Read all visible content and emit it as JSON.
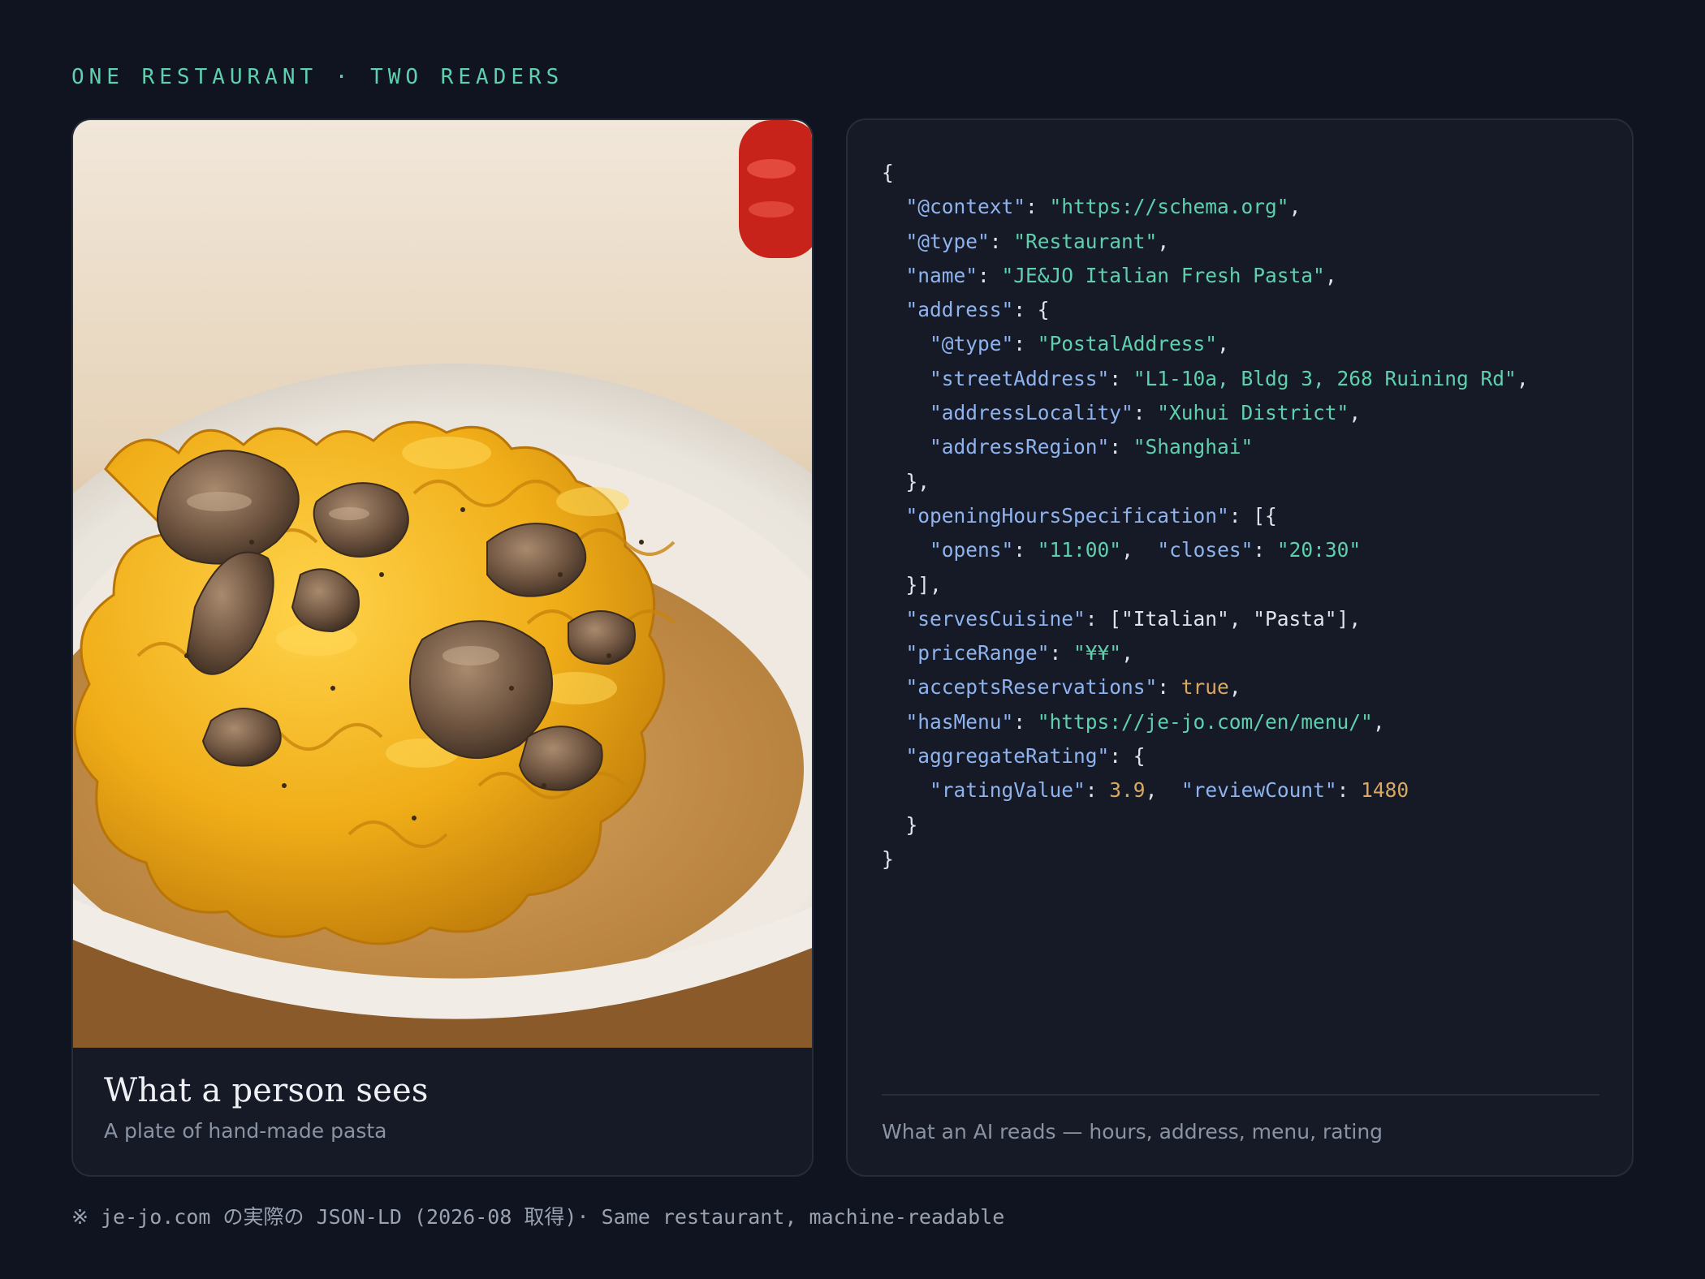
{
  "eyebrow": "ONE RESTAURANT · TWO READERS",
  "person_card": {
    "image_alt": "A plate of hand-made pasta with mushrooms in cream sauce",
    "title": "What a person sees",
    "subtitle": "A plate of hand-made pasta"
  },
  "ai_card": {
    "json_ld": {
      "open_brace": "{",
      "context_key": "\"@context\"",
      "context_val": "\"https://schema.org\"",
      "type_key": "\"@type\"",
      "type_val": "\"Restaurant\"",
      "name_key": "\"name\"",
      "name_val": "\"JE&JO Italian Fresh Pasta\"",
      "address_key": "\"address\"",
      "addr_type_key": "\"@type\"",
      "addr_type_val": "\"PostalAddress\"",
      "street_key": "\"streetAddress\"",
      "street_val": "\"L1-10a, Bldg 3, 268 Ruining Rd\"",
      "locality_key": "\"addressLocality\"",
      "locality_val": "\"Xuhui District\"",
      "region_key": "\"addressRegion\"",
      "region_val": "\"Shanghai\"",
      "hours_key": "\"openingHoursSpecification\"",
      "opens_key": "\"opens\"",
      "opens_val": "\"11:00\"",
      "closes_key": "\"closes\"",
      "closes_val": "\"20:30\"",
      "cuisine_key": "\"servesCuisine\"",
      "cuisine_val": "[\"Italian\", \"Pasta\"]",
      "price_key": "\"priceRange\"",
      "price_val": "\"¥¥\"",
      "reserv_key": "\"acceptsReservations\"",
      "reserv_val": "true",
      "menu_key": "\"hasMenu\"",
      "menu_val": "\"https://je-jo.com/en/menu/\"",
      "rating_key": "\"aggregateRating\"",
      "rating_value_key": "\"ratingValue\"",
      "rating_value_val": "3.9",
      "review_count_key": "\"reviewCount\"",
      "review_count_val": "1480",
      "close_brace": "}"
    },
    "caption": "What an AI reads — hours, address, menu, rating"
  },
  "footnote": "※ je-jo.com の実際の JSON-LD (2026-08 取得)· Same restaurant, machine-readable"
}
